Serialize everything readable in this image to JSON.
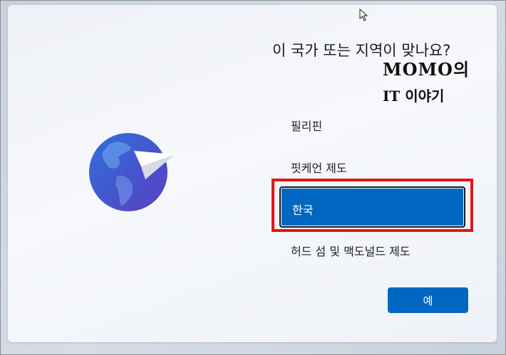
{
  "title": "이 국가 또는 지역이 맞나요?",
  "watermark": {
    "line1": "MOMO의",
    "line2": "IT 이야기"
  },
  "countries": [
    "필리핀",
    "핏케언 제도",
    "한국",
    "허드 섬 및 맥도널드 제도"
  ],
  "selected_country": "한국",
  "yes_button": "예",
  "colors": {
    "accent": "#0067c0",
    "highlight": "#e01818"
  }
}
